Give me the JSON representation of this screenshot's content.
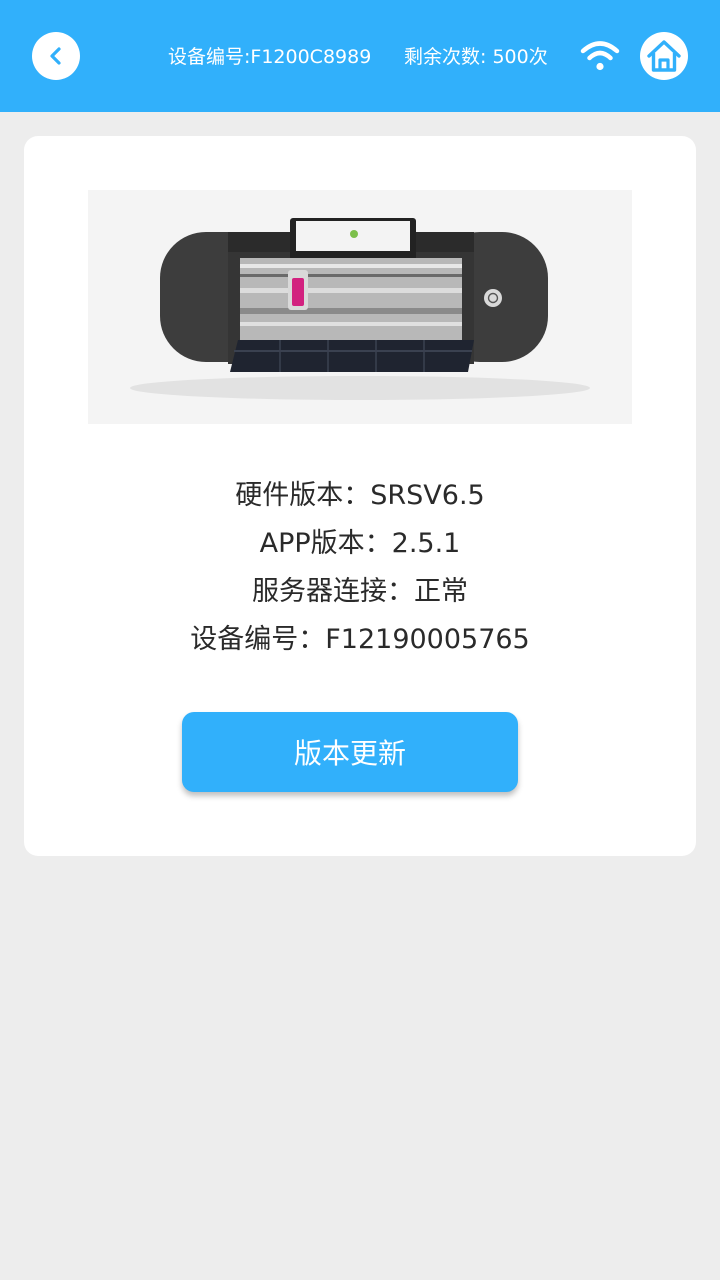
{
  "header": {
    "device_id_text": "设备编号:F1200C8989",
    "remaining_text": "剩余次数: 500次",
    "back_icon": "chevron-left-icon",
    "wifi_icon": "wifi-icon",
    "home_icon": "home-icon",
    "bar_color": "#31b0fb"
  },
  "device_card": {
    "image": "cutting-machine-image",
    "info": [
      {
        "text": "硬件版本：SRSV6.5"
      },
      {
        "text": "APP版本：2.5.1"
      },
      {
        "text": "服务器连接：正常"
      },
      {
        "text": "设备编号：F12190005765"
      }
    ],
    "update_button_label": "版本更新"
  }
}
